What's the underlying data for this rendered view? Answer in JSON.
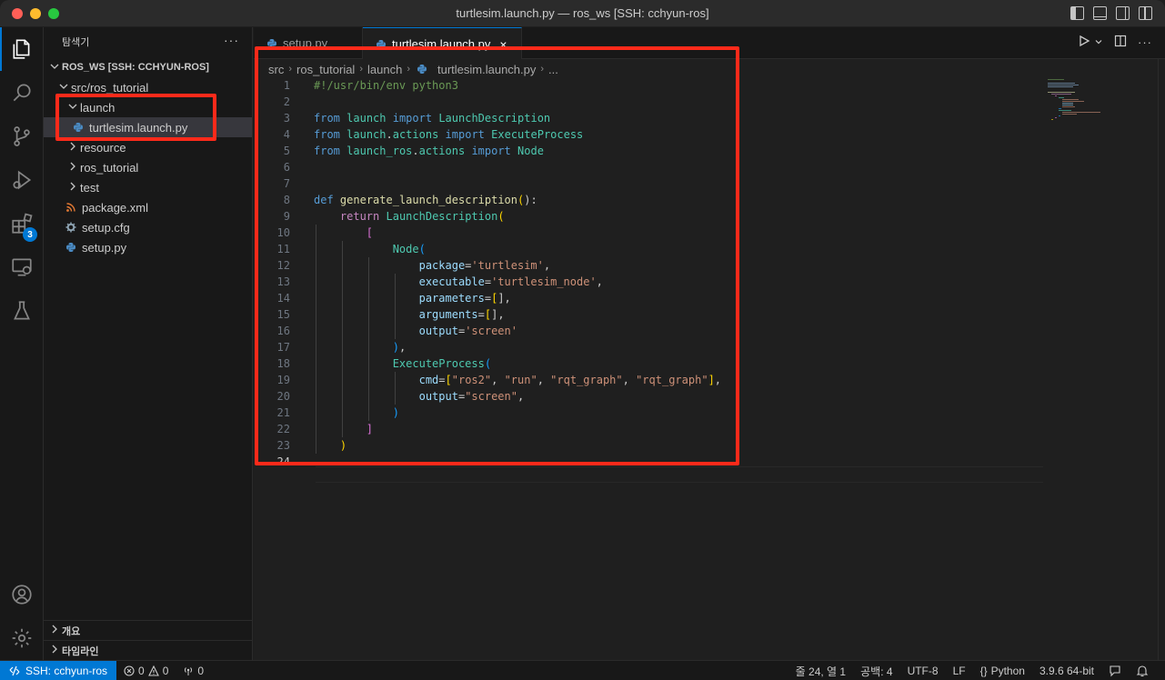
{
  "window": {
    "title": "turtlesim.launch.py — ros_ws [SSH: cchyun-ros]"
  },
  "activity_bar": {
    "extensions_badge": "3"
  },
  "sidebar": {
    "title": "탐색기",
    "more": "···",
    "workspace": "ROS_WS [SSH: CCHYUN-ROS]",
    "tree": [
      {
        "label": "src/ros_tutorial",
        "kind": "folder"
      },
      {
        "label": "launch",
        "kind": "folder"
      },
      {
        "label": "turtlesim.launch.py",
        "kind": "python"
      },
      {
        "label": "resource",
        "kind": "folder"
      },
      {
        "label": "ros_tutorial",
        "kind": "folder"
      },
      {
        "label": "test",
        "kind": "folder"
      },
      {
        "label": "package.xml",
        "kind": "xml"
      },
      {
        "label": "setup.cfg",
        "kind": "gear"
      },
      {
        "label": "setup.py",
        "kind": "python"
      }
    ],
    "outline": "개요",
    "timeline": "타임라인"
  },
  "tabs": [
    {
      "label": "setup.py",
      "active": false
    },
    {
      "label": "turtlesim.launch.py",
      "active": true
    }
  ],
  "breadcrumb": [
    "src",
    "ros_tutorial",
    "launch",
    "turtlesim.launch.py",
    "..."
  ],
  "editor": {
    "lines": [
      {
        "n": "1",
        "text": "#!/usr/bin/env python3"
      },
      {
        "n": "2",
        "text": ""
      },
      {
        "n": "3",
        "text": "from launch import LaunchDescription"
      },
      {
        "n": "4",
        "text": "from launch.actions import ExecuteProcess"
      },
      {
        "n": "5",
        "text": "from launch_ros.actions import Node"
      },
      {
        "n": "6",
        "text": ""
      },
      {
        "n": "7",
        "text": ""
      },
      {
        "n": "8",
        "text": "def generate_launch_description():"
      },
      {
        "n": "9",
        "text": "    return LaunchDescription("
      },
      {
        "n": "10",
        "text": "        ["
      },
      {
        "n": "11",
        "text": "            Node("
      },
      {
        "n": "12",
        "text": "                package='turtlesim',"
      },
      {
        "n": "13",
        "text": "                executable='turtlesim_node',"
      },
      {
        "n": "14",
        "text": "                parameters=[],"
      },
      {
        "n": "15",
        "text": "                arguments=[],"
      },
      {
        "n": "16",
        "text": "                output='screen'"
      },
      {
        "n": "17",
        "text": "            ),"
      },
      {
        "n": "18",
        "text": "            ExecuteProcess("
      },
      {
        "n": "19",
        "text": "                cmd=[\"ros2\", \"run\", \"rqt_graph\", \"rqt_graph\"],"
      },
      {
        "n": "20",
        "text": "                output=\"screen\","
      },
      {
        "n": "21",
        "text": "            )"
      },
      {
        "n": "22",
        "text": "        ]"
      },
      {
        "n": "23",
        "text": "    )"
      },
      {
        "n": "24",
        "text": ""
      }
    ]
  },
  "status_bar": {
    "remote": "SSH: cchyun-ros",
    "errors": "0",
    "warnings": "0",
    "ports": "0",
    "position": "줄 24, 열 1",
    "spaces": "공백: 4",
    "encoding": "UTF-8",
    "eol": "LF",
    "language": "Python",
    "interpreter": "3.9.6 64-bit"
  },
  "colors": {
    "accent": "#0078d4",
    "highlight_box": "#ff2a1a"
  }
}
